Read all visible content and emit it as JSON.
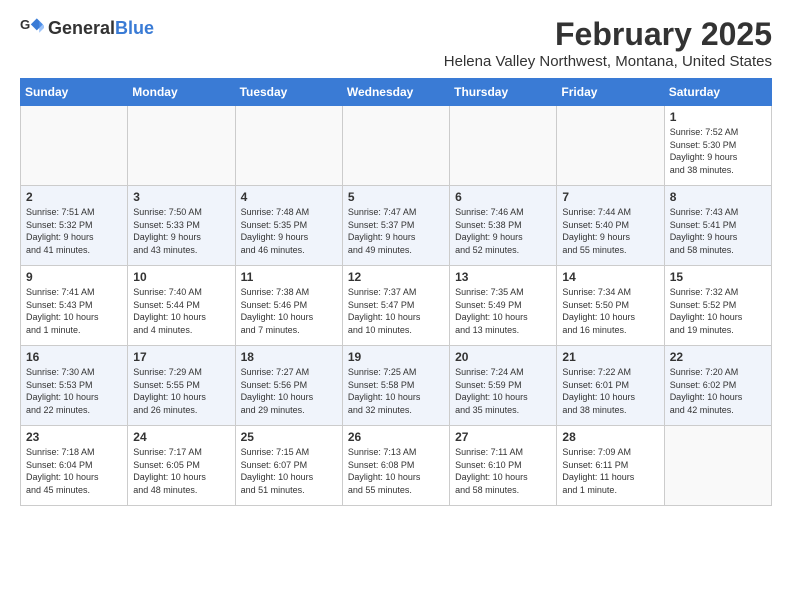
{
  "logo": {
    "general": "General",
    "blue": "Blue"
  },
  "title": "February 2025",
  "location": "Helena Valley Northwest, Montana, United States",
  "days_of_week": [
    "Sunday",
    "Monday",
    "Tuesday",
    "Wednesday",
    "Thursday",
    "Friday",
    "Saturday"
  ],
  "weeks": [
    [
      {
        "day": "",
        "info": ""
      },
      {
        "day": "",
        "info": ""
      },
      {
        "day": "",
        "info": ""
      },
      {
        "day": "",
        "info": ""
      },
      {
        "day": "",
        "info": ""
      },
      {
        "day": "",
        "info": ""
      },
      {
        "day": "1",
        "info": "Sunrise: 7:52 AM\nSunset: 5:30 PM\nDaylight: 9 hours\nand 38 minutes."
      }
    ],
    [
      {
        "day": "2",
        "info": "Sunrise: 7:51 AM\nSunset: 5:32 PM\nDaylight: 9 hours\nand 41 minutes."
      },
      {
        "day": "3",
        "info": "Sunrise: 7:50 AM\nSunset: 5:33 PM\nDaylight: 9 hours\nand 43 minutes."
      },
      {
        "day": "4",
        "info": "Sunrise: 7:48 AM\nSunset: 5:35 PM\nDaylight: 9 hours\nand 46 minutes."
      },
      {
        "day": "5",
        "info": "Sunrise: 7:47 AM\nSunset: 5:37 PM\nDaylight: 9 hours\nand 49 minutes."
      },
      {
        "day": "6",
        "info": "Sunrise: 7:46 AM\nSunset: 5:38 PM\nDaylight: 9 hours\nand 52 minutes."
      },
      {
        "day": "7",
        "info": "Sunrise: 7:44 AM\nSunset: 5:40 PM\nDaylight: 9 hours\nand 55 minutes."
      },
      {
        "day": "8",
        "info": "Sunrise: 7:43 AM\nSunset: 5:41 PM\nDaylight: 9 hours\nand 58 minutes."
      }
    ],
    [
      {
        "day": "9",
        "info": "Sunrise: 7:41 AM\nSunset: 5:43 PM\nDaylight: 10 hours\nand 1 minute."
      },
      {
        "day": "10",
        "info": "Sunrise: 7:40 AM\nSunset: 5:44 PM\nDaylight: 10 hours\nand 4 minutes."
      },
      {
        "day": "11",
        "info": "Sunrise: 7:38 AM\nSunset: 5:46 PM\nDaylight: 10 hours\nand 7 minutes."
      },
      {
        "day": "12",
        "info": "Sunrise: 7:37 AM\nSunset: 5:47 PM\nDaylight: 10 hours\nand 10 minutes."
      },
      {
        "day": "13",
        "info": "Sunrise: 7:35 AM\nSunset: 5:49 PM\nDaylight: 10 hours\nand 13 minutes."
      },
      {
        "day": "14",
        "info": "Sunrise: 7:34 AM\nSunset: 5:50 PM\nDaylight: 10 hours\nand 16 minutes."
      },
      {
        "day": "15",
        "info": "Sunrise: 7:32 AM\nSunset: 5:52 PM\nDaylight: 10 hours\nand 19 minutes."
      }
    ],
    [
      {
        "day": "16",
        "info": "Sunrise: 7:30 AM\nSunset: 5:53 PM\nDaylight: 10 hours\nand 22 minutes."
      },
      {
        "day": "17",
        "info": "Sunrise: 7:29 AM\nSunset: 5:55 PM\nDaylight: 10 hours\nand 26 minutes."
      },
      {
        "day": "18",
        "info": "Sunrise: 7:27 AM\nSunset: 5:56 PM\nDaylight: 10 hours\nand 29 minutes."
      },
      {
        "day": "19",
        "info": "Sunrise: 7:25 AM\nSunset: 5:58 PM\nDaylight: 10 hours\nand 32 minutes."
      },
      {
        "day": "20",
        "info": "Sunrise: 7:24 AM\nSunset: 5:59 PM\nDaylight: 10 hours\nand 35 minutes."
      },
      {
        "day": "21",
        "info": "Sunrise: 7:22 AM\nSunset: 6:01 PM\nDaylight: 10 hours\nand 38 minutes."
      },
      {
        "day": "22",
        "info": "Sunrise: 7:20 AM\nSunset: 6:02 PM\nDaylight: 10 hours\nand 42 minutes."
      }
    ],
    [
      {
        "day": "23",
        "info": "Sunrise: 7:18 AM\nSunset: 6:04 PM\nDaylight: 10 hours\nand 45 minutes."
      },
      {
        "day": "24",
        "info": "Sunrise: 7:17 AM\nSunset: 6:05 PM\nDaylight: 10 hours\nand 48 minutes."
      },
      {
        "day": "25",
        "info": "Sunrise: 7:15 AM\nSunset: 6:07 PM\nDaylight: 10 hours\nand 51 minutes."
      },
      {
        "day": "26",
        "info": "Sunrise: 7:13 AM\nSunset: 6:08 PM\nDaylight: 10 hours\nand 55 minutes."
      },
      {
        "day": "27",
        "info": "Sunrise: 7:11 AM\nSunset: 6:10 PM\nDaylight: 10 hours\nand 58 minutes."
      },
      {
        "day": "28",
        "info": "Sunrise: 7:09 AM\nSunset: 6:11 PM\nDaylight: 11 hours\nand 1 minute."
      },
      {
        "day": "",
        "info": ""
      }
    ]
  ]
}
